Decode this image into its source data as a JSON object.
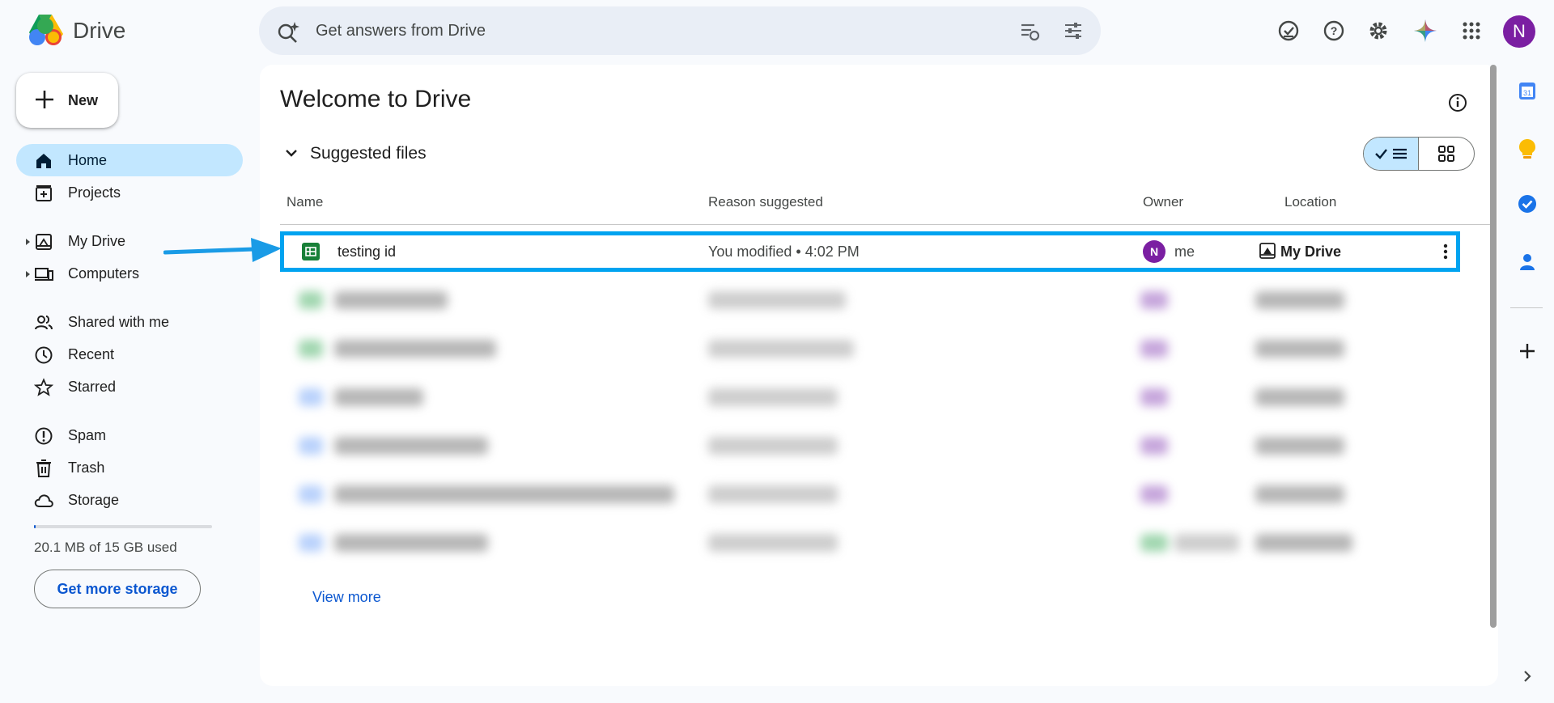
{
  "app": {
    "name": "Drive"
  },
  "search": {
    "placeholder": "Get answers from Drive"
  },
  "header": {
    "avatar_letter": "N"
  },
  "sidebar": {
    "new_label": "New",
    "items": [
      {
        "label": "Home",
        "icon": "home-icon",
        "active": true
      },
      {
        "label": "Projects",
        "icon": "projects-icon"
      },
      {
        "label": "My Drive",
        "icon": "my-drive-icon"
      },
      {
        "label": "Computers",
        "icon": "computers-icon"
      },
      {
        "label": "Shared with me",
        "icon": "shared-icon"
      },
      {
        "label": "Recent",
        "icon": "clock-icon"
      },
      {
        "label": "Starred",
        "icon": "star-icon"
      },
      {
        "label": "Spam",
        "icon": "spam-icon"
      },
      {
        "label": "Trash",
        "icon": "trash-icon"
      },
      {
        "label": "Storage",
        "icon": "cloud-icon"
      }
    ],
    "storage_text": "20.1 MB of 15 GB used",
    "storage_fraction": 0.0013,
    "storage_button": "Get more storage"
  },
  "main": {
    "title": "Welcome to Drive",
    "section_title": "Suggested files",
    "columns": [
      "Name",
      "Reason suggested",
      "Owner",
      "Location"
    ],
    "highlighted_file": {
      "name": "testing id",
      "reason": "You modified • 4:02 PM",
      "owner_letter": "N",
      "owner": "me",
      "location": "My Drive"
    },
    "view_more": "View more"
  },
  "right_panel": {
    "calendar_day": "31"
  },
  "colors": {
    "accent": "#0b57d0",
    "active_nav": "#c2e7ff",
    "highlight": "#00a3f0",
    "avatar": "#7b1fa2",
    "sheets": "#188038"
  }
}
